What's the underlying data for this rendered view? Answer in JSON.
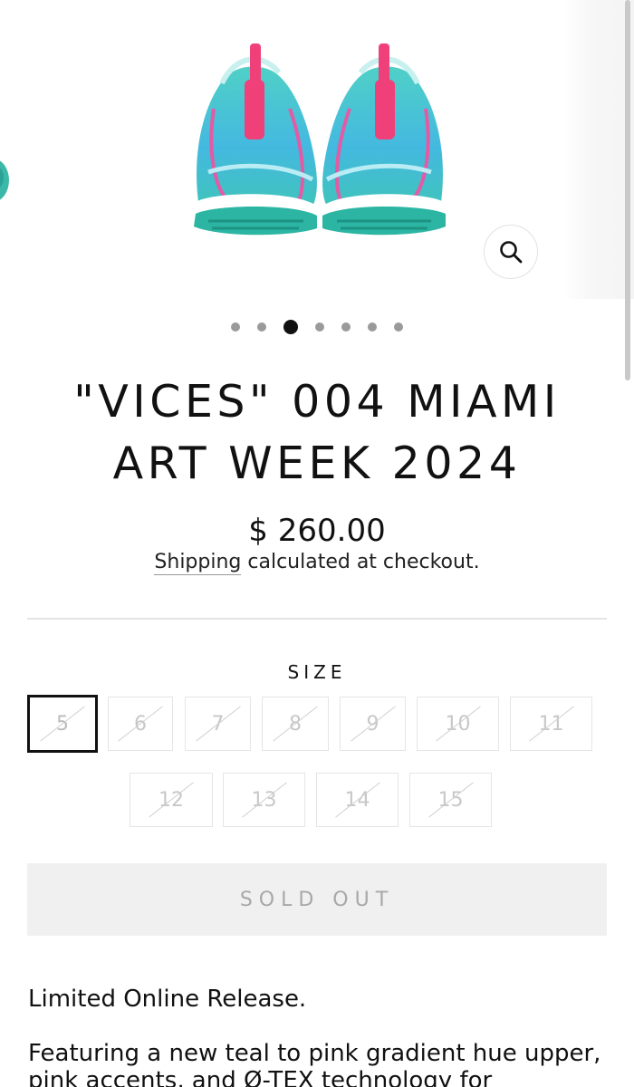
{
  "gallery": {
    "image_alt": "Teal to pink gradient sneakers, front view",
    "zoom_icon": "search-icon",
    "dot_count": 7,
    "active_dot": 3
  },
  "product": {
    "title": "\"VICES\" 004 MIAMI ART WEEK 2024",
    "price": "$ 260.00",
    "shipping_link": "Shipping",
    "shipping_rest": " calculated at checkout."
  },
  "size": {
    "label": "SIZE",
    "selected": "5",
    "options": [
      "5",
      "6",
      "7",
      "8",
      "9",
      "10",
      "11",
      "12",
      "13",
      "14",
      "15"
    ]
  },
  "buy_button": {
    "label": "SOLD OUT"
  },
  "description": {
    "line1": "Limited Online Release.",
    "line2": "Featuring a new teal to pink gradient hue upper, pink accents, and Ø-TEX technology for"
  },
  "colors": {
    "teal": "#3bc2b4",
    "pink": "#f0407a",
    "text": "#111111"
  }
}
